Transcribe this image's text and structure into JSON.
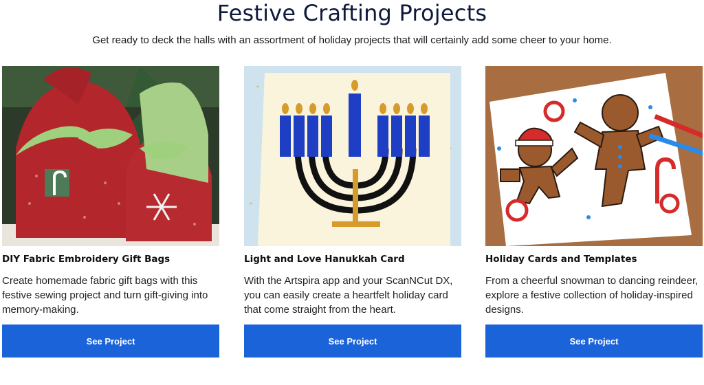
{
  "header": {
    "title": "Festive Crafting Projects",
    "subtitle": "Get ready to deck the halls with an assortment of holiday projects that will certainly add some cheer to your home."
  },
  "cards": [
    {
      "title": "DIY Fabric Embroidery Gift Bags",
      "description": "Create homemade fabric gift bags with this festive sewing project and turn gift-giving into memory-making.",
      "button_label": "See Project",
      "image_icon": "gift-bags-photo"
    },
    {
      "title": "Light and Love Hanukkah Card",
      "description": "With the Artspira app and your ScanNCut DX, you can easily create a heartfelt holiday card that come straight from the heart.",
      "button_label": "See Project",
      "image_icon": "menorah-card-photo"
    },
    {
      "title": "Holiday Cards and Templates",
      "description": "From a cheerful snowman to dancing reindeer, explore a festive collection of holiday-inspired designs.",
      "button_label": "See Project",
      "image_icon": "gingerbread-coloring-photo"
    }
  ],
  "colors": {
    "button": "#1a63d8",
    "title": "#0e1a3a"
  }
}
